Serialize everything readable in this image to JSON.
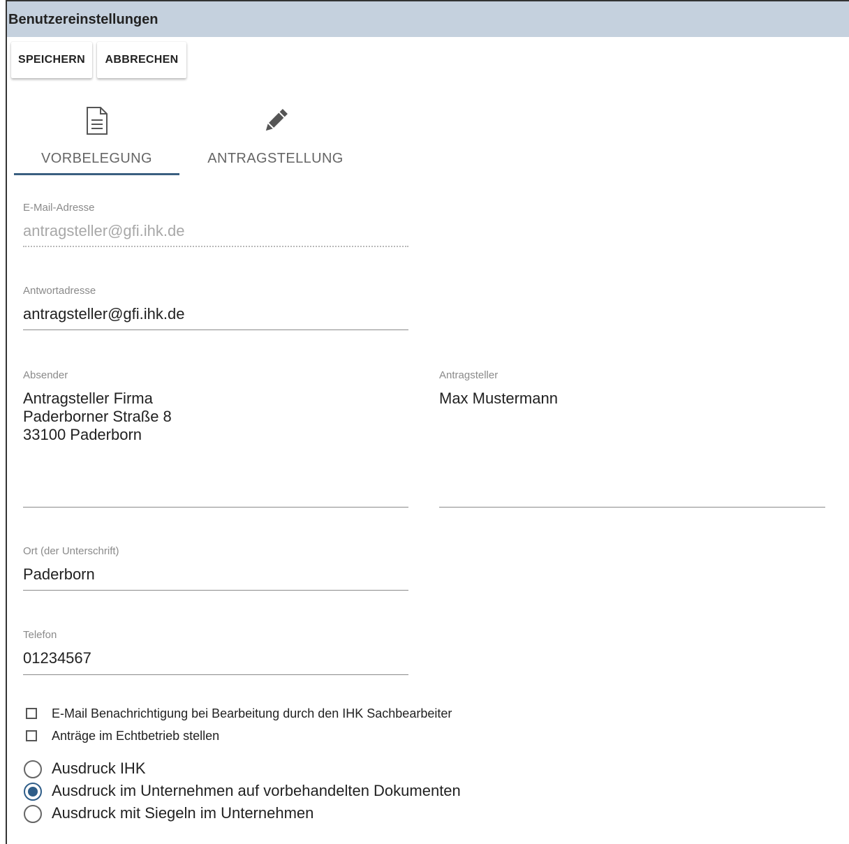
{
  "window": {
    "title": "Benutzereinstellungen"
  },
  "toolbar": {
    "save_label": "SPEICHERN",
    "cancel_label": "ABBRECHEN"
  },
  "tabs": [
    {
      "label": "VORBELEGUNG",
      "icon": "document-icon",
      "active": true
    },
    {
      "label": "ANTRAGSTELLUNG",
      "icon": "pencil-icon",
      "active": false
    }
  ],
  "fields": {
    "email": {
      "label": "E-Mail-Adresse",
      "value": "antragsteller@gfi.ihk.de",
      "disabled": true
    },
    "reply": {
      "label": "Antwortadresse",
      "value": "antragsteller@gfi.ihk.de"
    },
    "sender": {
      "label": "Absender",
      "value": "Antragsteller Firma\nPaderborner Straße 8\n33100 Paderborn"
    },
    "applicant": {
      "label": "Antragsteller",
      "value": "Max Mustermann"
    },
    "place": {
      "label": "Ort (der Unterschrift)",
      "value": "Paderborn"
    },
    "phone": {
      "label": "Telefon",
      "value": "01234567"
    }
  },
  "checkboxes": [
    {
      "label": "E-Mail Benachrichtigung bei Bearbeitung durch den IHK Sachbearbeiter",
      "checked": false
    },
    {
      "label": "Anträge im Echtbetrieb stellen",
      "checked": false
    }
  ],
  "radios": [
    {
      "label": "Ausdruck IHK",
      "checked": false
    },
    {
      "label": "Ausdruck im Unternehmen auf vorbehandelten Dokumenten",
      "checked": true
    },
    {
      "label": "Ausdruck mit Siegeln im Unternehmen",
      "checked": false
    }
  ],
  "colors": {
    "accent": "#2e5d88",
    "titlebar": "#c5d1de",
    "tab_indicator": "#3a5f80"
  }
}
